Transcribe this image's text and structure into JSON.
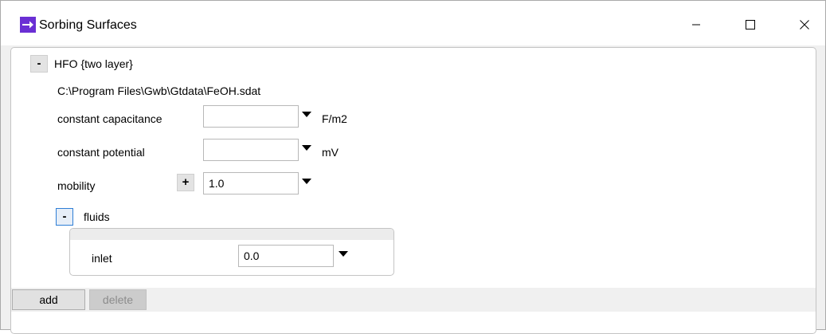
{
  "window": {
    "title": "Sorbing Surfaces",
    "controls": {
      "minimize": "minimize-icon",
      "maximize": "maximize-icon",
      "close": "close-icon"
    }
  },
  "surface": {
    "toggle": "-",
    "name": "HFO {two layer}",
    "path": "C:\\Program Files\\Gwb\\Gtdata\\FeOH.sdat",
    "constant_capacitance": {
      "label": "constant capacitance",
      "value": "",
      "unit": "F/m2"
    },
    "constant_potential": {
      "label": "constant potential",
      "value": "",
      "unit": "mV"
    },
    "mobility": {
      "label": "mobility",
      "toggle": "+",
      "value": "1.0"
    },
    "fluids": {
      "toggle": "-",
      "label": "fluids",
      "inlet": {
        "label": "inlet",
        "value": "0.0"
      }
    }
  },
  "buttons": {
    "add": "add",
    "delete": "delete"
  },
  "colors": {
    "app_icon": "#6a2fd4",
    "focus_border": "#2f7fd6",
    "disabled_text": "#8c8c8c"
  }
}
